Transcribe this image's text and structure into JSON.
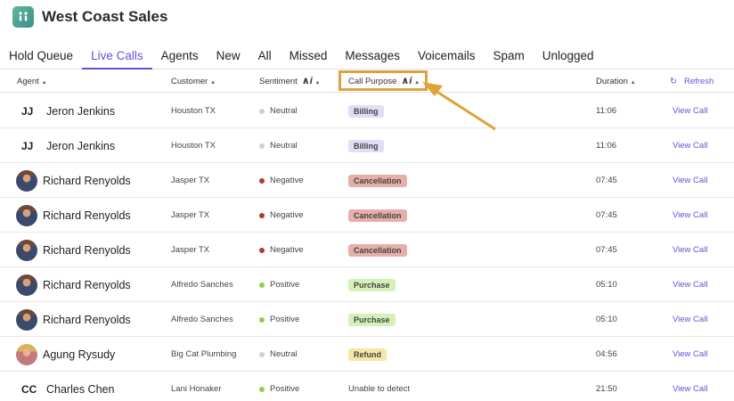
{
  "app": {
    "title": "West Coast Sales"
  },
  "tabs": [
    "Hold Queue",
    "Live Calls",
    "Agents",
    "New",
    "All",
    "Missed",
    "Messages",
    "Voicemails",
    "Spam",
    "Unlogged"
  ],
  "active_tab": "Live Calls",
  "columns": {
    "agent": "Agent",
    "customer": "Customer",
    "sentiment": "Sentiment",
    "call_purpose": "Call Purpose",
    "duration": "Duration",
    "refresh": "Refresh",
    "ai_glyph": "AI"
  },
  "colors": {
    "accent": "#6b4fd8",
    "highlight": "#e0a23a",
    "neutral": "#cfcfd6",
    "negative": "#b23a2a",
    "positive": "#8ad14a",
    "billing_bg": "#e2ddf7",
    "cancellation_bg": "#e6b0a8",
    "purchase_bg": "#d4f2b8",
    "refund_bg": "#f7e6a6"
  },
  "rows": [
    {
      "agent": "Jeron Jenkins",
      "initials": "JJ",
      "avatar": "",
      "customer": "Houston TX",
      "sentiment": "Neutral",
      "purpose": "Billing",
      "duration": "11:06",
      "action": "View Call"
    },
    {
      "agent": "Jeron Jenkins",
      "initials": "JJ",
      "avatar": "",
      "customer": "Houston TX",
      "sentiment": "Neutral",
      "purpose": "Billing",
      "duration": "11:06",
      "action": "View Call"
    },
    {
      "agent": "Richard Renyolds",
      "initials": "",
      "avatar": "rr",
      "customer": "Jasper TX",
      "sentiment": "Negative",
      "purpose": "Cancellation",
      "duration": "07:45",
      "action": "View Call"
    },
    {
      "agent": "Richard Renyolds",
      "initials": "",
      "avatar": "rr",
      "customer": "Jasper TX",
      "sentiment": "Negative",
      "purpose": "Cancellation",
      "duration": "07:45",
      "action": "View Call"
    },
    {
      "agent": "Richard Renyolds",
      "initials": "",
      "avatar": "rr",
      "customer": "Jasper TX",
      "sentiment": "Negative",
      "purpose": "Cancellation",
      "duration": "07:45",
      "action": "View Call"
    },
    {
      "agent": "Richard Renyolds",
      "initials": "",
      "avatar": "rr",
      "customer": "Alfredo Sanches",
      "sentiment": "Positive",
      "purpose": "Purchase",
      "duration": "05:10",
      "action": "View Call"
    },
    {
      "agent": "Richard Renyolds",
      "initials": "",
      "avatar": "rr",
      "customer": "Alfredo Sanches",
      "sentiment": "Positive",
      "purpose": "Purchase",
      "duration": "05:10",
      "action": "View Call"
    },
    {
      "agent": "Agung Rysudy",
      "initials": "",
      "avatar": "ar",
      "customer": "Big Cat Plumbing",
      "sentiment": "Neutral",
      "purpose": "Refund",
      "duration": "04:56",
      "action": "View Call"
    },
    {
      "agent": "Charles Chen",
      "initials": "CC",
      "avatar": "",
      "customer": "Lani Honaker",
      "sentiment": "Positive",
      "purpose": "Unable to detect",
      "duration": "21:50",
      "action": "View Call"
    }
  ]
}
